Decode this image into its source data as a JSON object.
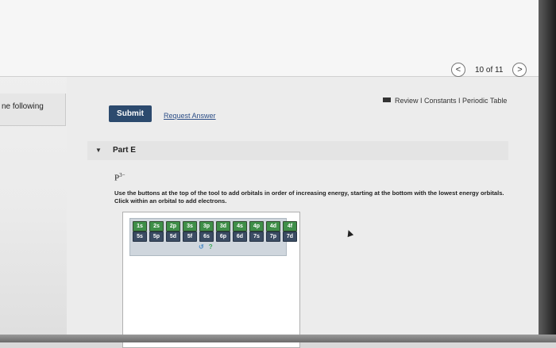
{
  "header": {
    "pager_text": "10 of 11",
    "prev_glyph": "<",
    "next_glyph": ">"
  },
  "left_panel": {
    "text": "ne following"
  },
  "references": {
    "text": "Review I Constants I Periodic Table"
  },
  "actions": {
    "submit_label": "Submit",
    "request_answer_label": "Request Answer"
  },
  "part": {
    "title": "Part E",
    "ion_base": "P",
    "ion_charge": "3−",
    "instruction": "Use the buttons at the top of the tool to add orbitals in order of increasing energy, starting at the bottom with the lowest energy orbitals. Click within an orbital to add electrons."
  },
  "orbital_tool": {
    "row1": [
      "1s",
      "2s",
      "2p",
      "3s",
      "3p",
      "3d",
      "4s",
      "4p",
      "4d",
      "4f"
    ],
    "row2": [
      "5s",
      "5p",
      "5d",
      "5f",
      "6s",
      "6p",
      "6d",
      "7s",
      "7p",
      "7d"
    ],
    "undo_glyph": "↺",
    "help_glyph": "?"
  },
  "colors": {
    "submit_bg": "#2c4a6e",
    "orbital_row1": "#3f8f49",
    "orbital_row2": "#3b4c63",
    "link": "#2b4d86"
  }
}
